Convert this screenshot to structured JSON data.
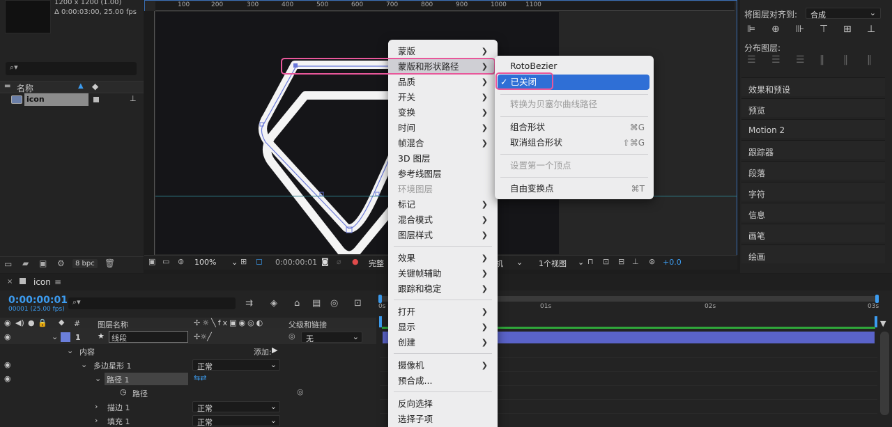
{
  "project": {
    "meta_line1": "1200 x 1200 (1.00)",
    "meta_line2": "Δ 0:00:03:00, 25.00 fps",
    "col_name": "名称",
    "item_name": "icon",
    "bpc": "8 bpc"
  },
  "viewer": {
    "ruler_top": [
      "100",
      "200",
      "300",
      "400",
      "500",
      "600",
      "700",
      "800",
      "900",
      "1000",
      "1100"
    ],
    "zoom": "100%",
    "timecode": "0:00:00:01",
    "quality": "完整",
    "view_mode_tail": "机",
    "views": "1个视图",
    "exposure": "+0.0"
  },
  "context_menu": {
    "items": [
      {
        "label": "蒙版",
        "arrow": true
      },
      {
        "label": "蒙版和形状路径",
        "arrow": true,
        "highlight": true
      },
      {
        "label": "品质",
        "arrow": true
      },
      {
        "label": "开关",
        "arrow": true
      },
      {
        "label": "变换",
        "arrow": true
      },
      {
        "label": "时间",
        "arrow": true
      },
      {
        "label": "帧混合",
        "arrow": true
      },
      {
        "label": "3D 图层",
        "arrow": false
      },
      {
        "label": "参考线图层",
        "arrow": false
      },
      {
        "label": "环境图层",
        "arrow": false,
        "disabled": true
      },
      {
        "label": "标记",
        "arrow": true
      },
      {
        "label": "混合模式",
        "arrow": true
      },
      {
        "label": "图层样式",
        "arrow": true
      },
      {
        "label": "效果",
        "arrow": true
      },
      {
        "label": "关键帧辅助",
        "arrow": true
      },
      {
        "label": "跟踪和稳定",
        "arrow": true
      },
      {
        "label": "打开",
        "arrow": true
      },
      {
        "label": "显示",
        "arrow": true
      },
      {
        "label": "创建",
        "arrow": true
      },
      {
        "label": "摄像机",
        "arrow": true
      },
      {
        "label": "预合成...",
        "arrow": false
      },
      {
        "label": "反向选择",
        "arrow": false
      },
      {
        "label": "选择子项",
        "arrow": false
      }
    ]
  },
  "submenu": {
    "rotobezier": "RotoBezier",
    "closed_check": "✓",
    "closed": "已关闭",
    "convert_bezier": "转换为贝塞尔曲线路径",
    "group_shapes": "组合形状",
    "group_shortcut": "⌘G",
    "ungroup_shapes": "取消组合形状",
    "ungroup_shortcut": "⇧⌘G",
    "set_first_vertex": "设置第一个顶点",
    "free_transform": "自由变换点",
    "free_transform_shortcut": "⌘T"
  },
  "right_panel": {
    "align_label": "将图层对齐到:",
    "align_target": "合成",
    "distribute_label": "分布图层:",
    "sections": [
      "效果和预设",
      "预览",
      "Motion 2",
      "跟踪器",
      "段落",
      "字符",
      "信息",
      "画笔",
      "绘画"
    ]
  },
  "timeline": {
    "tab_name": "icon",
    "timecode": "0:00:00:01",
    "fps": "00001 (25.00 fps)",
    "col_hash": "#",
    "col_layer_name": "图层名称",
    "col_parent": "父级和链接",
    "ruler_ticks": [
      "0s",
      "01s",
      "02s",
      "03s"
    ],
    "layer": {
      "index": "1",
      "name": "线段",
      "parent": "无"
    },
    "content_label": "内容",
    "add_label": "添加:",
    "polystar": "多边星形 1",
    "polystar_mode": "正常",
    "path1": "路径 1",
    "path": "路径",
    "stroke": "描边 1",
    "stroke_mode": "正常",
    "fill": "填充 1",
    "fill_mode": "正常"
  },
  "colors": {
    "accent_blue": "#3c9cf0",
    "highlight_pink": "#e8579a",
    "selection_blue": "#2f6fd6",
    "layer_bar": "#5a63c9"
  }
}
